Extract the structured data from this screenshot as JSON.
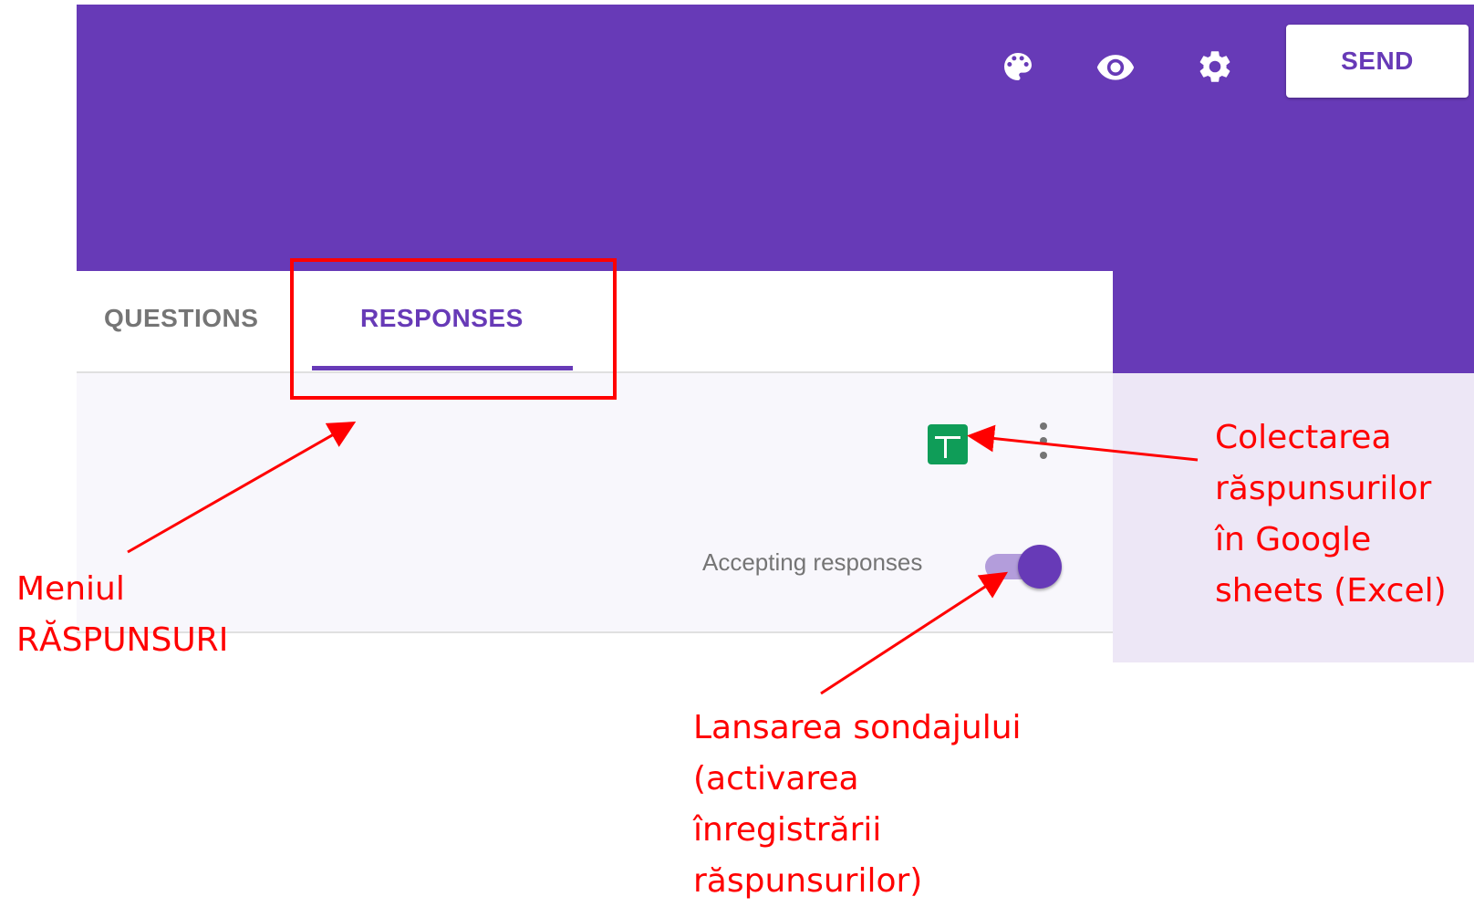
{
  "header": {
    "toolbar": [
      {
        "icon": "palette-icon",
        "tooltip": ""
      },
      {
        "icon": "eye-icon",
        "tooltip": ""
      },
      {
        "icon": "gear-icon",
        "tooltip": ""
      }
    ],
    "send_label": "SEND"
  },
  "tabs": [
    {
      "label": "QUESTIONS",
      "active": false
    },
    {
      "label": "RESPONSES",
      "active": true
    }
  ],
  "responses": {
    "sheets_icon": "google-sheets-icon",
    "more_icon": "more-vert-icon",
    "accepting_label": "Accepting responses",
    "accepting_on": true
  },
  "annotations": {
    "menu": [
      "Meniul",
      "RĂSPUNSURI"
    ],
    "sheets": [
      "Colectarea",
      "răspunsurilor",
      "în Google",
      "sheets (Excel)"
    ],
    "launch": [
      "Lansarea sondajului",
      "(activarea",
      "înregistrării",
      "răspunsurilor)"
    ]
  },
  "colors": {
    "brand": "#673ab7",
    "brand_light": "#ede7f6",
    "sheets_green": "#0f9d58",
    "annotation_red": "#ff0000"
  }
}
